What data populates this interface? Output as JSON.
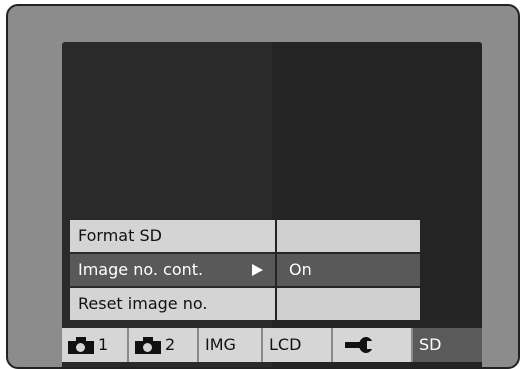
{
  "menu": {
    "items": [
      {
        "label": "Format SD",
        "value": ""
      },
      {
        "label": "Image no. cont.",
        "value": "On",
        "selected": true
      },
      {
        "label": "Reset image no.",
        "value": ""
      }
    ]
  },
  "tabs": [
    {
      "icon": "camera-icon",
      "label": "1"
    },
    {
      "icon": "camera-icon",
      "label": "2"
    },
    {
      "label": "IMG"
    },
    {
      "label": "LCD"
    },
    {
      "icon": "wrench-icon",
      "label": ""
    },
    {
      "label": "SD",
      "active": true
    }
  ],
  "colors": {
    "selected_bg": "#595959",
    "menu_bg": "#d4d4d4",
    "screen_bg": "#2a2a2a",
    "frame_bg": "#8c8c8c"
  }
}
